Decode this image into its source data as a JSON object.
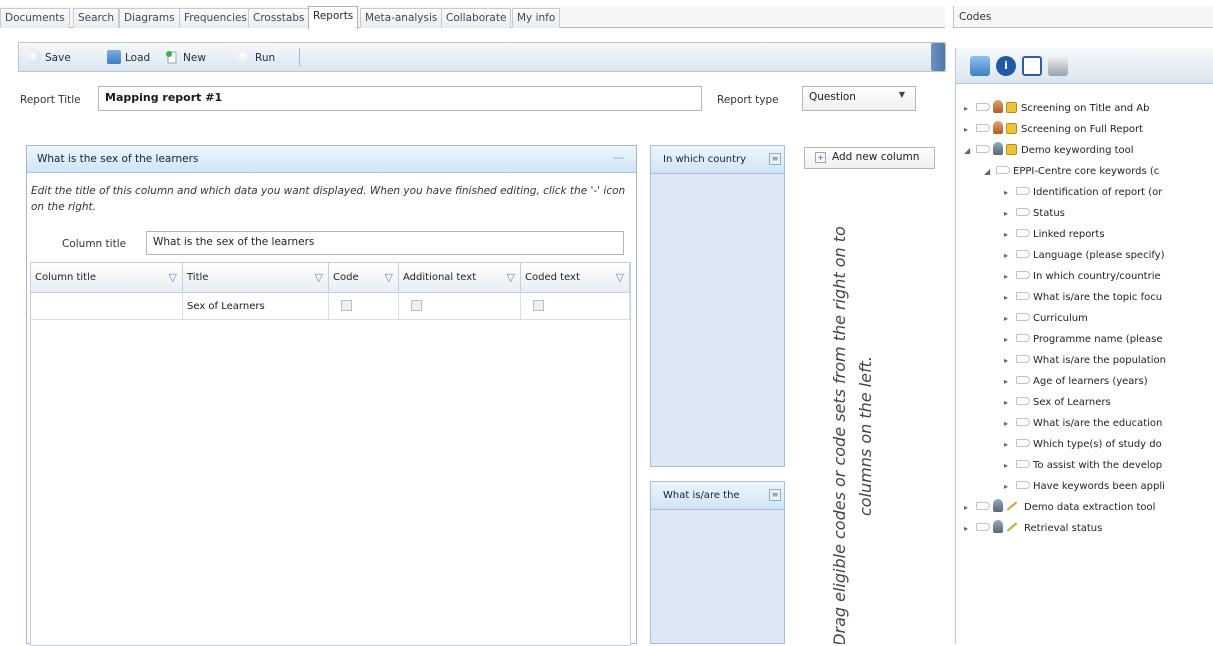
{
  "tabs": [
    "Documents",
    "Search",
    "Diagrams",
    "Frequencies",
    "Crosstabs",
    "Reports",
    "Meta-analysis",
    "Collaborate",
    "My info"
  ],
  "active_tab": "Reports",
  "toolbar": {
    "save": "Save",
    "load": "Load",
    "new": "New",
    "run": "Run"
  },
  "report": {
    "title_label": "Report Title",
    "title_value": "Mapping report #1",
    "type_label": "Report type",
    "type_value": "Question"
  },
  "column": {
    "header": "What is the sex of the learners",
    "header_action": "—",
    "instructions": "Edit the title of this column and which data you want displayed. When you have finished editing, click the '-' icon on the right.",
    "title_label": "Column title",
    "title_value": "What is the sex of the learners",
    "grid_headers": [
      "Column title",
      "Title",
      "Code",
      "Additional text",
      "Coded text"
    ],
    "rows": [
      {
        "column_title": "",
        "title": "Sex of Learners"
      }
    ]
  },
  "stub_columns": [
    "In which country",
    "What is/are the"
  ],
  "add_column": "Add new column",
  "hint": "Drag eligible codes or code sets from the right on to columns on the left.",
  "codes": {
    "title": "Codes",
    "tree": [
      {
        "label": "Screening on Title and Ab",
        "icon": "lock-icon"
      },
      {
        "label": "Screening on Full Report",
        "icon": "lock-icon"
      },
      {
        "label": "Demo keywording tool",
        "icon": "lock-icon"
      },
      {
        "label": "EPPI-Centre core keywords (c",
        "icon": ""
      },
      {
        "label": "Identification of report (or",
        "icon": ""
      },
      {
        "label": "Status",
        "icon": ""
      },
      {
        "label": "Linked reports",
        "icon": ""
      },
      {
        "label": "Language (please specify)",
        "icon": ""
      },
      {
        "label": "In which country/countrie",
        "icon": ""
      },
      {
        "label": "What is/are the topic focu",
        "icon": ""
      },
      {
        "label": "Curriculum",
        "icon": ""
      },
      {
        "label": "Programme name (please",
        "icon": ""
      },
      {
        "label": "What is/are the population",
        "icon": ""
      },
      {
        "label": "Age of learners (years)",
        "icon": ""
      },
      {
        "label": "Sex of Learners",
        "icon": ""
      },
      {
        "label": "What is/are the education",
        "icon": ""
      },
      {
        "label": "Which type(s) of study do",
        "icon": ""
      },
      {
        "label": "To assist with the develop",
        "icon": ""
      },
      {
        "label": "Have keywords been appli",
        "icon": ""
      },
      {
        "label": "Demo data extraction tool",
        "icon": "pencil-icon"
      },
      {
        "label": "Retrieval status",
        "icon": "pencil-icon"
      }
    ]
  }
}
